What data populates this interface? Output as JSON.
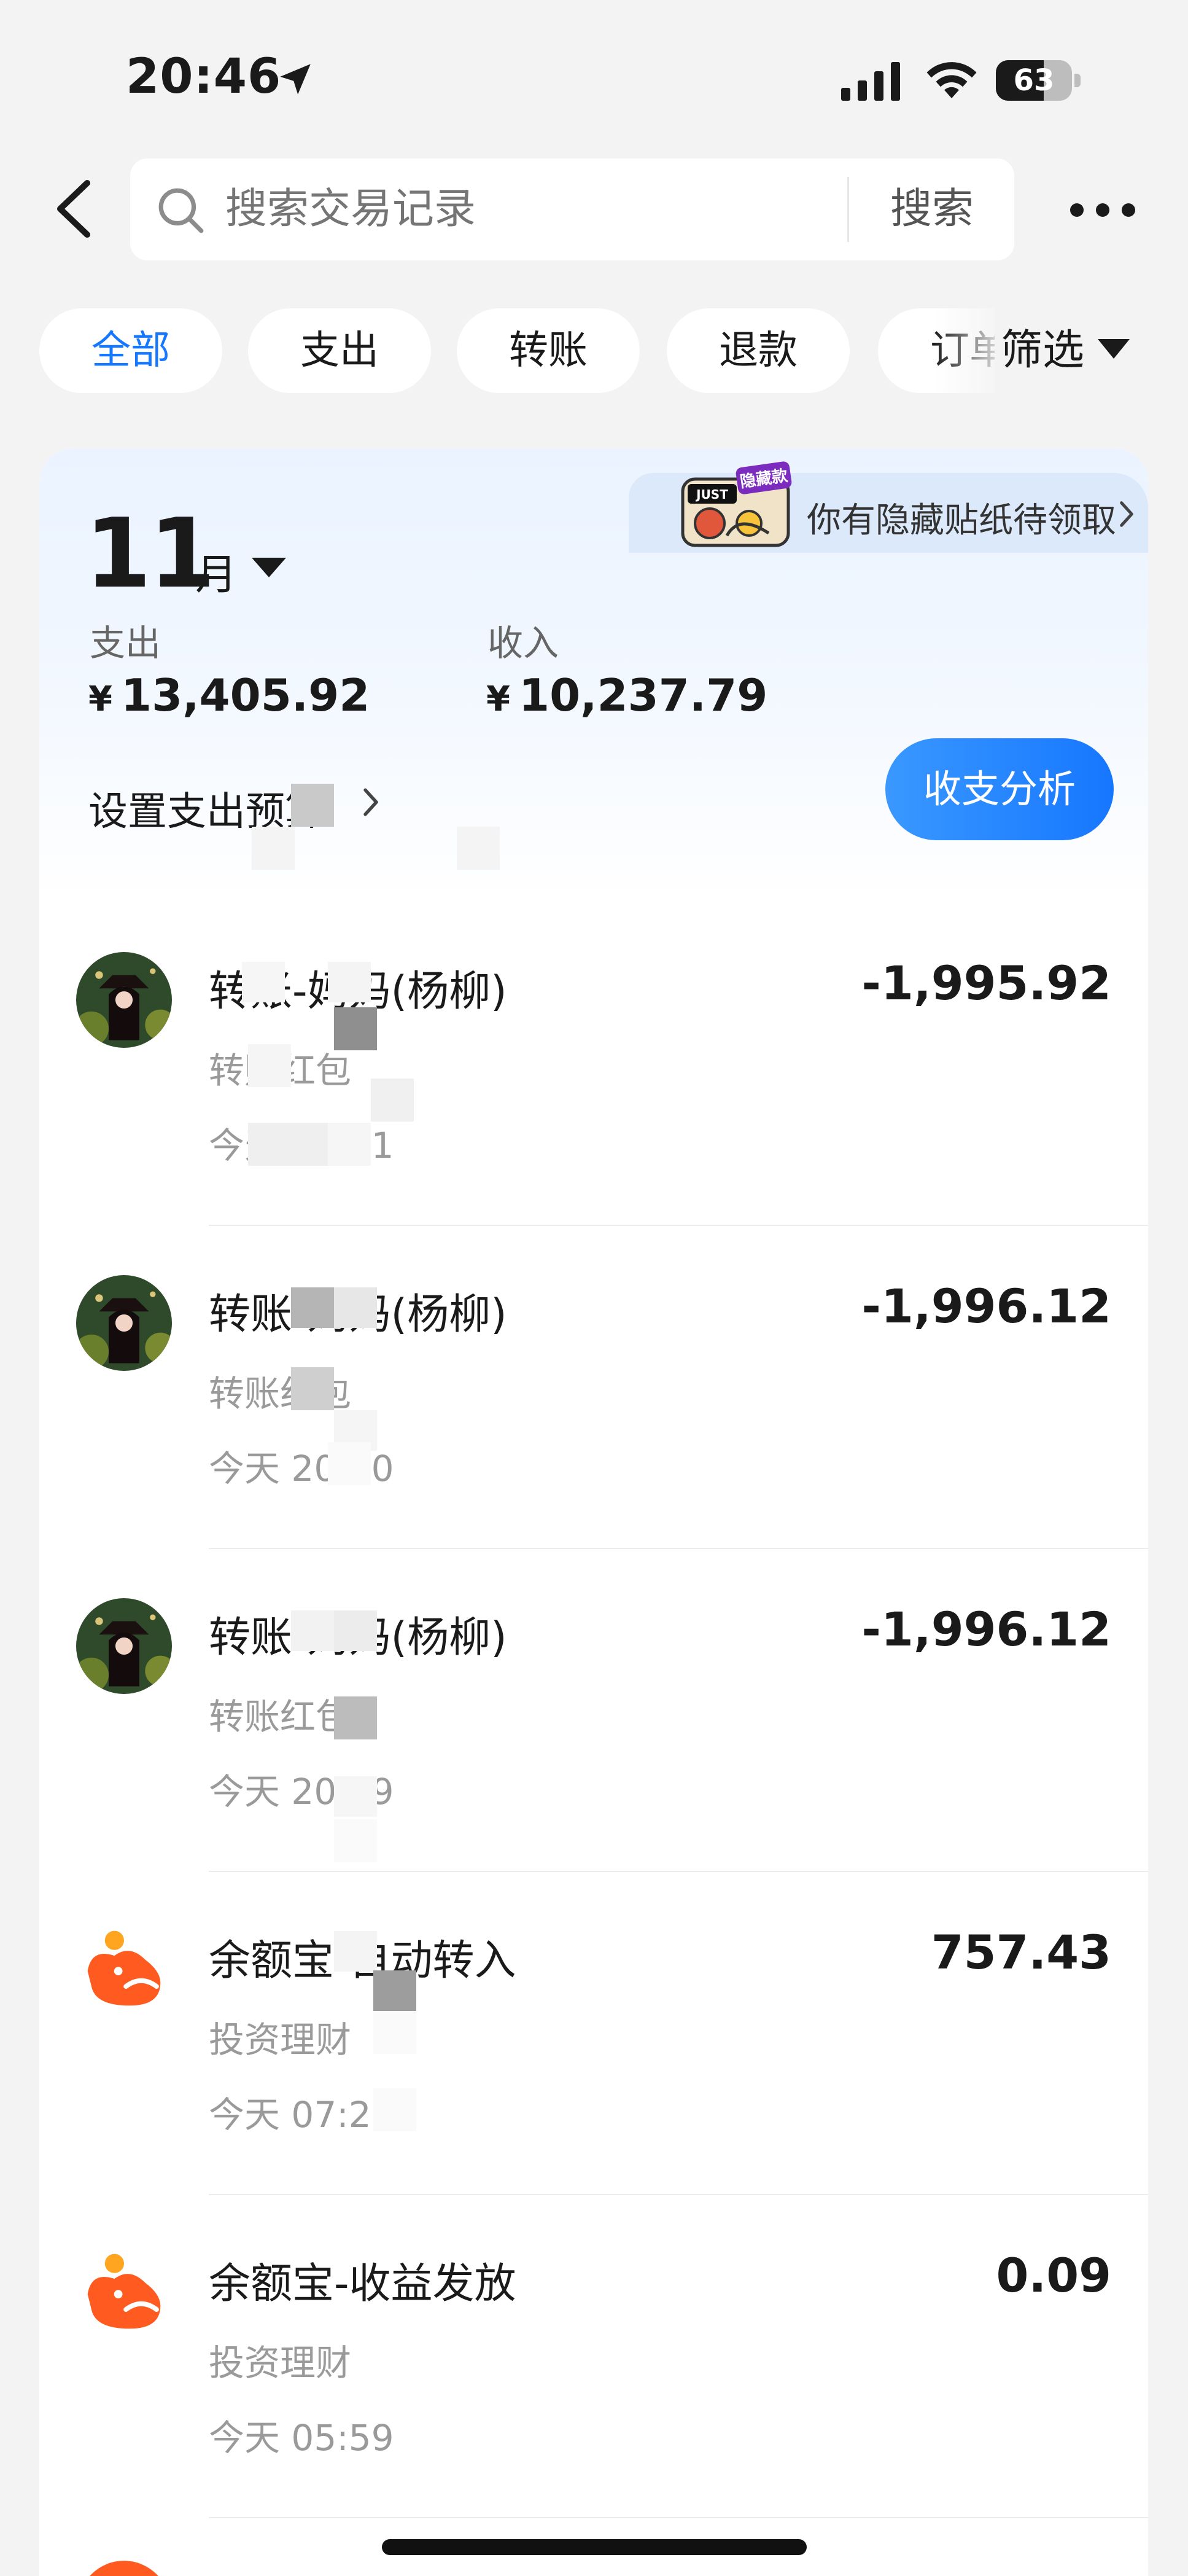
{
  "status_bar": {
    "time": "20:46",
    "battery": "63",
    "battery_level": 0.63
  },
  "search": {
    "placeholder": "搜索交易记录",
    "button_label": "搜索"
  },
  "filters": {
    "tabs": [
      {
        "label": "全部",
        "active": true
      },
      {
        "label": "支出",
        "active": false
      },
      {
        "label": "转账",
        "active": false
      },
      {
        "label": "退款",
        "active": false
      },
      {
        "label": "订单",
        "active": false
      }
    ],
    "dropdown_label": "筛选"
  },
  "promo": {
    "sticker_text": "JUST",
    "sticker_badge": "隐藏款",
    "text": "你有隐藏贴纸待领取"
  },
  "summary": {
    "month_number": "11",
    "month_unit": "月",
    "expense_label": "支出",
    "expense_currency": "¥",
    "expense_amount": "13,405.92",
    "income_label": "收入",
    "income_currency": "¥",
    "income_amount": "10,237.79",
    "budget_link": "设置支出预算",
    "analysis_button": "收支分析"
  },
  "transactions": [
    {
      "title": "转账-妈妈(杨柳)",
      "category": "转账红包",
      "time": "今天 20:41",
      "amount": "-1,995.92",
      "icon": "user-avatar"
    },
    {
      "title": "转账-妈妈(杨柳)",
      "category": "转账红包",
      "time": "今天 20:40",
      "amount": "-1,996.12",
      "icon": "user-avatar"
    },
    {
      "title": "转账-妈妈(杨柳)",
      "category": "转账红包",
      "time": "今天 20:39",
      "amount": "-1,996.12",
      "icon": "user-avatar"
    },
    {
      "title": "余额宝-自动转入",
      "category": "投资理财",
      "time": "今天 07:29",
      "amount": "757.43",
      "icon": "yuebao-icon"
    },
    {
      "title": "余额宝-收益发放",
      "category": "投资理财",
      "time": "今天 05:59",
      "amount": "0.09",
      "icon": "yuebao-icon"
    }
  ],
  "colors": {
    "accent": "#1677ff",
    "background": "#f3f3f3",
    "yuebao_orange": "#ff5a1f"
  }
}
